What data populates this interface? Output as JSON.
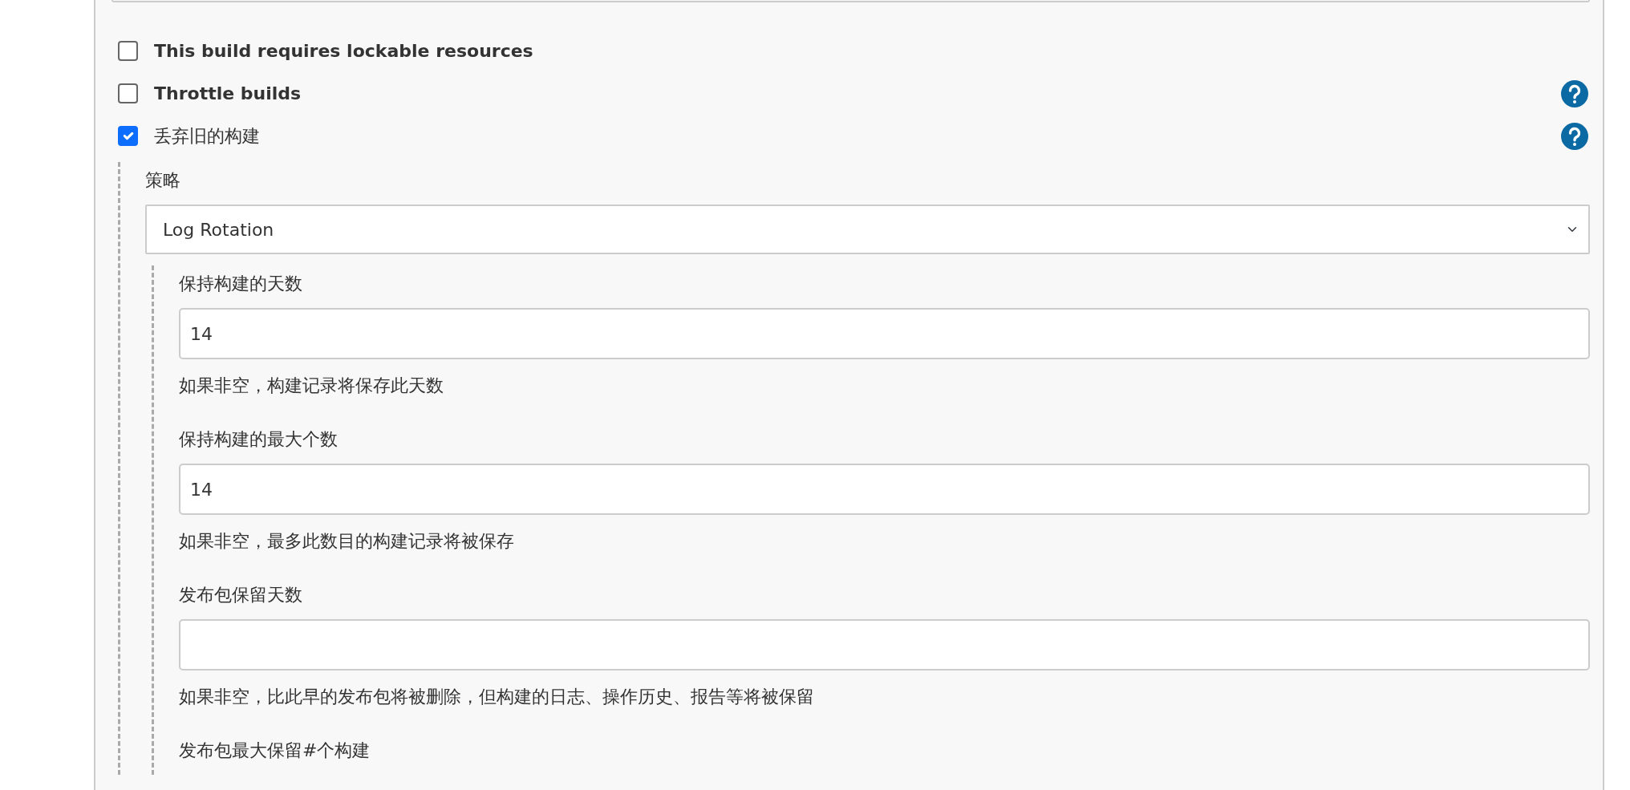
{
  "options": [
    {
      "label": "This build requires lockable resources",
      "checked": false,
      "bold": true,
      "help": false
    },
    {
      "label": "Throttle builds",
      "checked": false,
      "bold": true,
      "help": true
    },
    {
      "label": "丢弃旧的构建",
      "checked": true,
      "bold": false,
      "help": true
    }
  ],
  "strategy": {
    "label": "策略",
    "value": "Log Rotation"
  },
  "fields": [
    {
      "kind": "field",
      "label": "保持构建的天数",
      "value": "14",
      "hint": "如果非空，构建记录将保存此天数"
    },
    {
      "kind": "field",
      "label": "保持构建的最大个数",
      "value": "14",
      "hint": "如果非空，最多此数目的构建记录将被保存"
    },
    {
      "kind": "field",
      "label": "发布包保留天数",
      "hint": "如果非空，比此早的发布包将被删除，但构建的日志、操作历史、报告等将被保留"
    },
    {
      "kind": "heading",
      "label": "发布包最大保留#个构建"
    }
  ]
}
